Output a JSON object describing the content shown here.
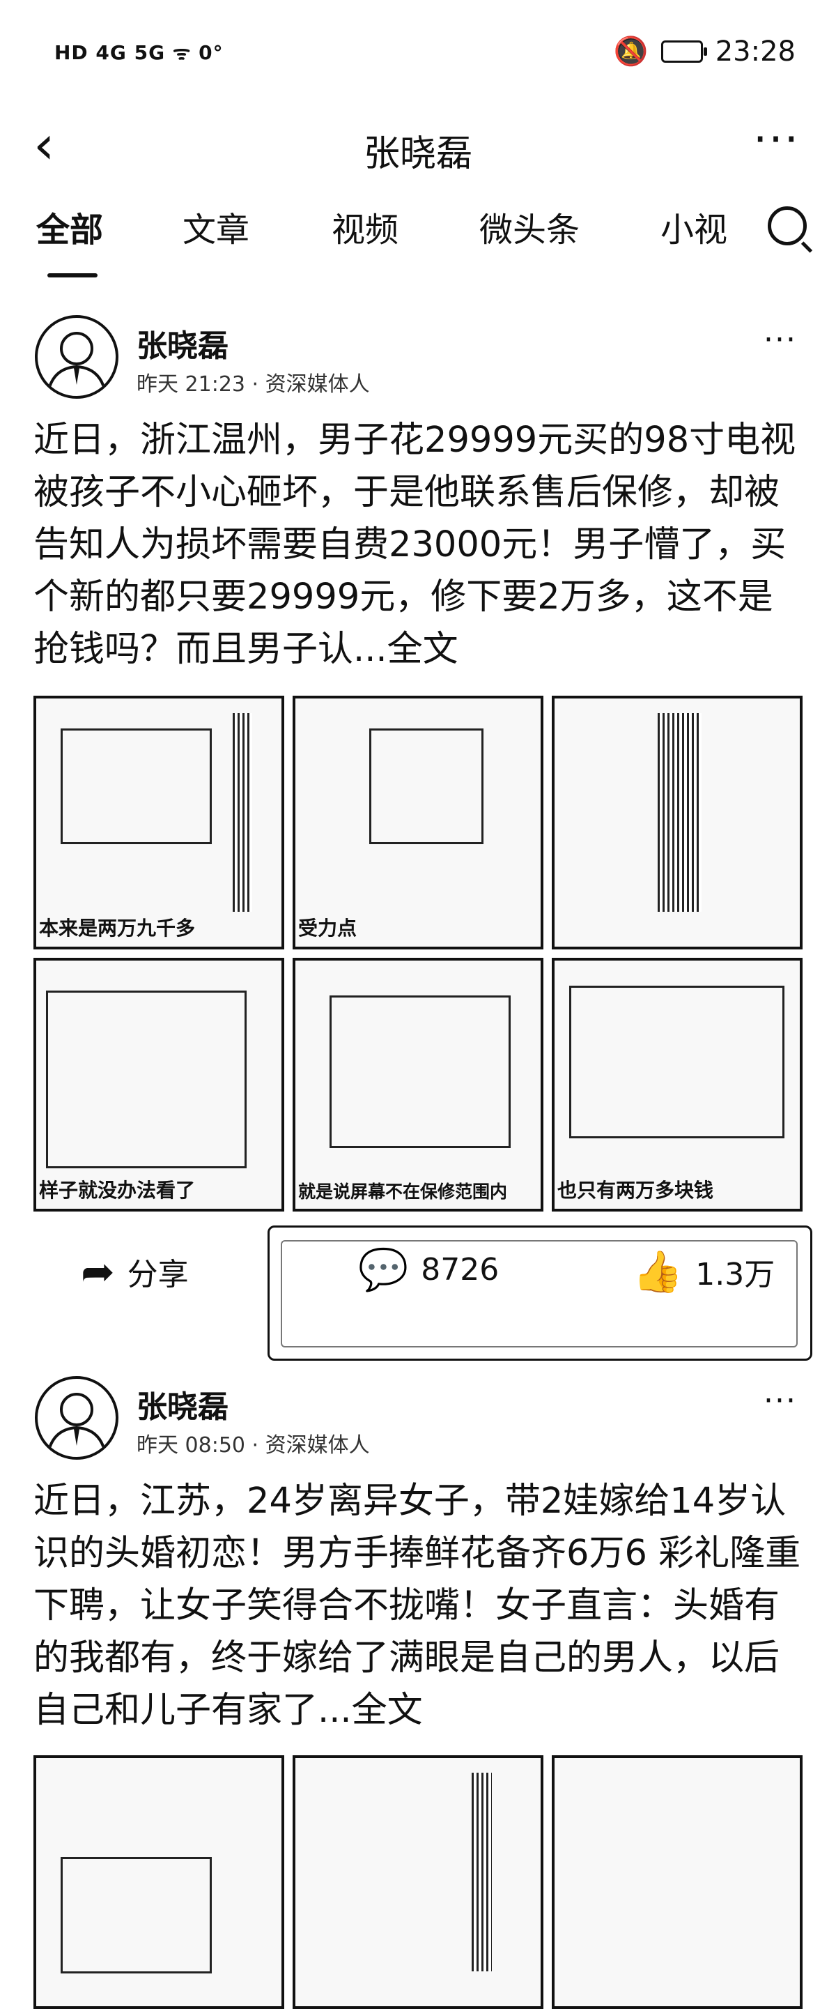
{
  "status_bar": {
    "left": "HD 4G 5G ᯤ 0°",
    "time": "23:28"
  },
  "nav": {
    "title": "张晓磊"
  },
  "tabs": [
    "全部",
    "文章",
    "视频",
    "微头条",
    "小视"
  ],
  "posts": [
    {
      "author": "张晓磊",
      "meta": "昨天  21:23 · 资深媒体人",
      "text": "近日，浙江温州，男子花29999元买的98寸电视被孩子不小心砸坏，于是他联系售后保修，却被告知人为损坏需要自费23000元！男子懵了，买个新的都只要29999元，修下要2万多，这不是抢钱吗？而且男子认...全文",
      "captions": [
        "本来是两万九千多",
        "受力点",
        "",
        "样子就没办法看了",
        "就是说屏幕不在保修范围内",
        "也只有两万多块钱"
      ],
      "actions": {
        "share": "分享",
        "comments": "8726",
        "likes": "1.3万"
      }
    },
    {
      "author": "张晓磊",
      "meta": "昨天  08:50 · 资深媒体人",
      "text": "近日，江苏，24岁离异女子，带2娃嫁给14岁认识的头婚初恋！男方手捧鲜花备齐6万6 彩礼隆重下聘，让女子笑得合不拢嘴！女子直言：头婚有的我都有，终于嫁给了满眼是自己的男人，以后自己和儿子有家了...全文"
    }
  ]
}
